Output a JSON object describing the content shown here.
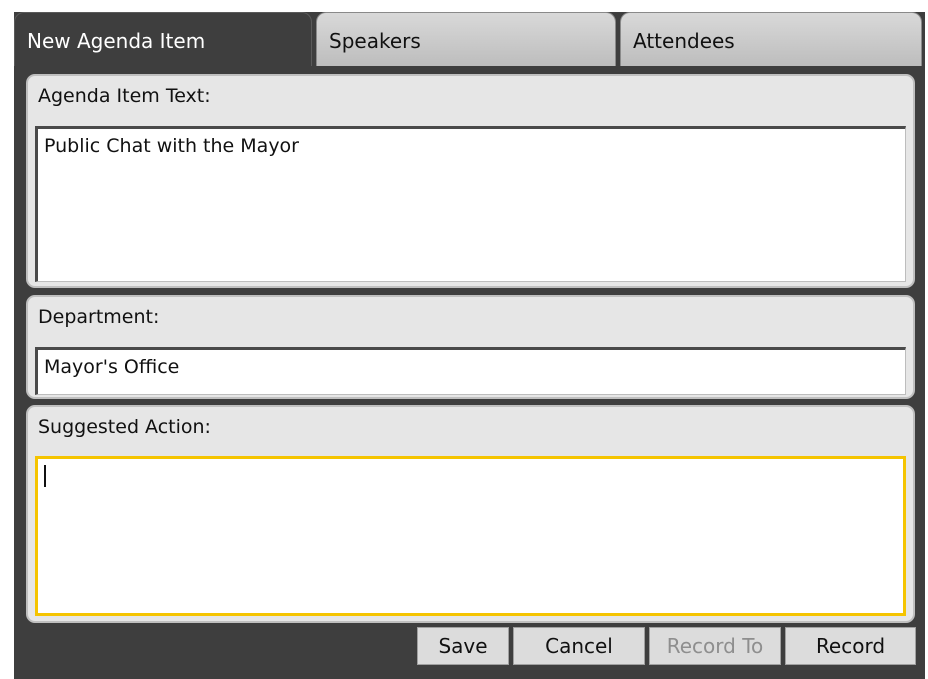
{
  "tabs": [
    {
      "label": "New Agenda Item",
      "active": true
    },
    {
      "label": "Speakers",
      "active": false
    },
    {
      "label": "Attendees",
      "active": false
    }
  ],
  "agenda_item": {
    "label": "Agenda Item Text:",
    "value": "Public Chat with the Mayor"
  },
  "department": {
    "label": "Department:",
    "value": "Mayor's Office"
  },
  "suggested_action": {
    "label": "Suggested Action:",
    "value": ""
  },
  "buttons": {
    "save": "Save",
    "cancel": "Cancel",
    "record_to": "Record To",
    "record": "Record"
  },
  "colors": {
    "window_bg": "#3e3e3e",
    "panel_bg": "#e6e6e6",
    "focus_border": "#f5c400",
    "disabled_text": "#8e8e8e"
  }
}
